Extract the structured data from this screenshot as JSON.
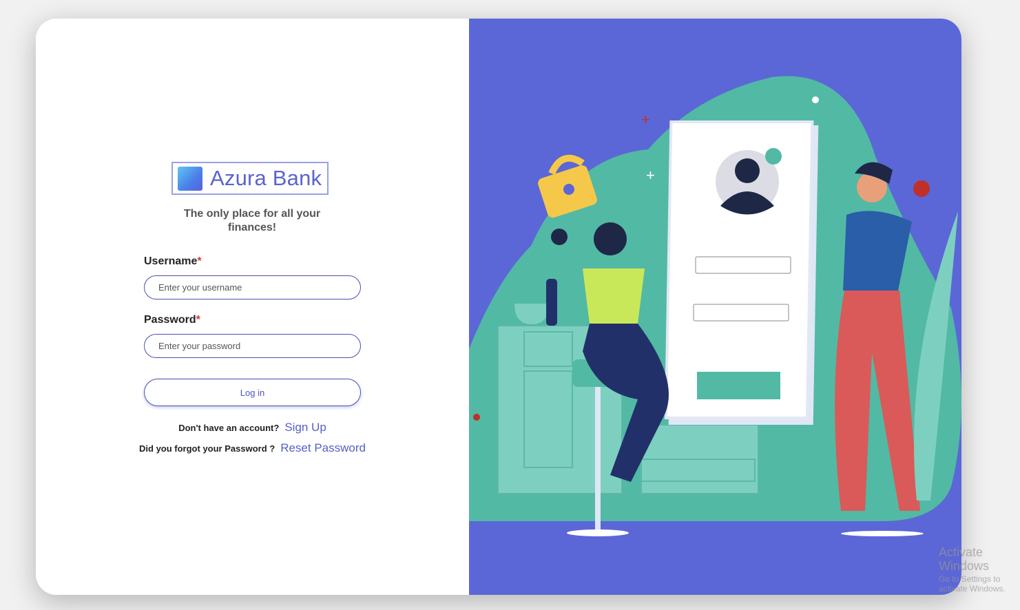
{
  "brand": {
    "name": "Azura Bank",
    "tagline": "The only place for all your finances!"
  },
  "form": {
    "username_label": "Username",
    "username_placeholder": "Enter your username",
    "password_label": "Password",
    "password_placeholder": "Enter your password",
    "required_mark": "*",
    "login_label": "Log in"
  },
  "links": {
    "signup_prompt": "Don't have an account?",
    "signup_label": "Sign Up",
    "reset_prompt": "Did you forgot your Password ?",
    "reset_label": "Reset Password"
  },
  "colors": {
    "accent": "#5a64cc",
    "panel": "#5b67d6",
    "teal": "#52b9a5"
  },
  "watermark": {
    "line1": "Activate Windows",
    "line2": "Go to Settings to activate Windows."
  }
}
